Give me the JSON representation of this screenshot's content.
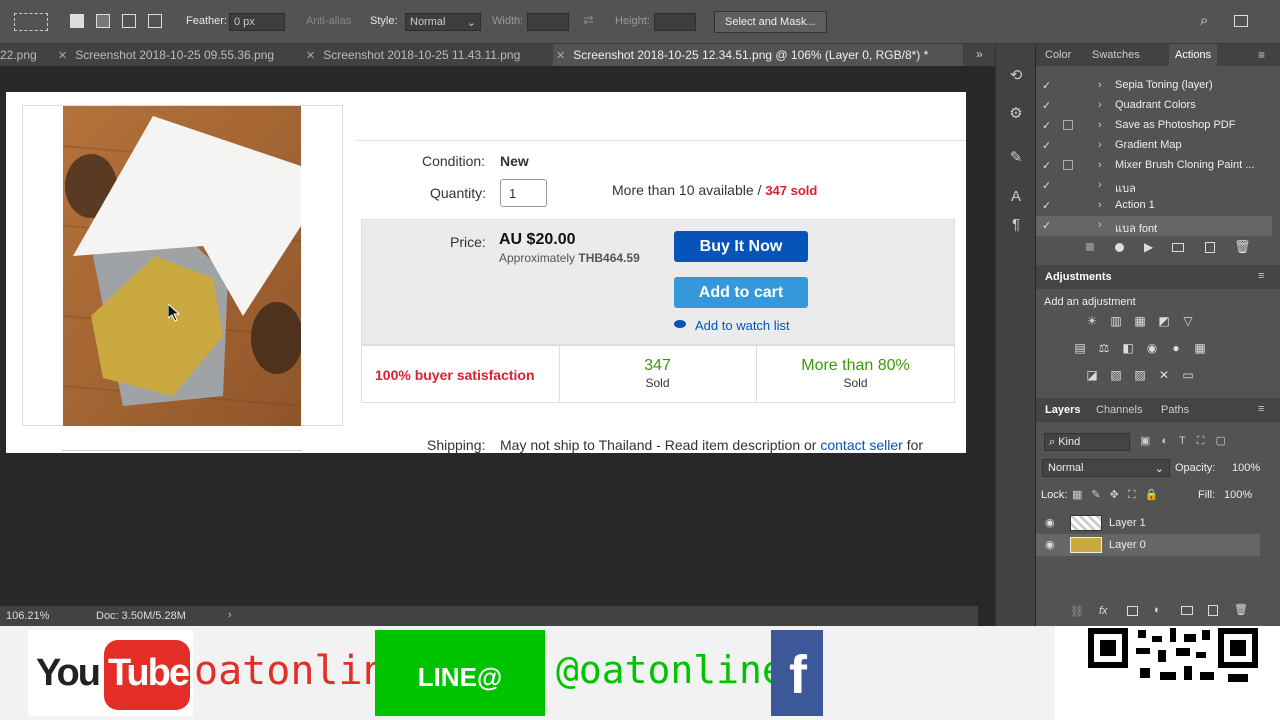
{
  "options_bar": {
    "feather_label": "Feather:",
    "feather_value": "0 px",
    "anti_alias_label": "Anti-alias",
    "style_label": "Style:",
    "style_value": "Normal",
    "width_label": "Width:",
    "height_label": "Height:",
    "select_mask_label": "Select and Mask..."
  },
  "tabs": [
    {
      "label": "22.png"
    },
    {
      "label": "Screenshot 2018-10-25 09.55.36.png"
    },
    {
      "label": "Screenshot 2018-10-25 11.43.11.png"
    },
    {
      "label": "Screenshot 2018-10-25 12.34.51.png @ 106% (Layer 0, RGB/8*) *"
    }
  ],
  "listing": {
    "condition_label": "Condition:",
    "condition_value": "New",
    "quantity_label": "Quantity:",
    "quantity_value": "1",
    "availability": "More than 10 available /",
    "sold_count": "347 sold",
    "price_label": "Price:",
    "price_value": "AU $20.00",
    "approx_label": "Approximately",
    "approx_value": "THB464.59",
    "buy_now": "Buy It Now",
    "add_to_cart": "Add to cart",
    "watch": "Add to watch list",
    "satisfaction": "100% buyer satisfaction",
    "stat_sold_num": "347",
    "stat_sold_label": "Sold",
    "stat_pct_num": "More than 80%",
    "stat_pct_label": "Sold",
    "shipping_label": "Shipping:",
    "shipping_text": "May not ship to Thailand - Read item description or",
    "contact_seller": "contact seller",
    "shipping_tail": "for"
  },
  "status_bar": {
    "zoom": "106.21%",
    "doc": "Doc: 3.50M/5.28M"
  },
  "panel_tabs": {
    "color": "Color",
    "swatches": "Swatches",
    "actions": "Actions"
  },
  "actions": [
    {
      "label": "Sepia Toning (layer)",
      "box": false
    },
    {
      "label": "Quadrant Colors",
      "box": false
    },
    {
      "label": "Save as Photoshop PDF",
      "box": true
    },
    {
      "label": "Gradient Map",
      "box": false
    },
    {
      "label": "Mixer Brush Cloning Paint ...",
      "box": true
    },
    {
      "label": "แบล",
      "box": false
    },
    {
      "label": "Action 1",
      "box": false
    },
    {
      "label": "แบล font",
      "box": false
    }
  ],
  "adjustments": {
    "title": "Adjustments",
    "subtitle": "Add an adjustment"
  },
  "layers_tabs": {
    "layers": "Layers",
    "channels": "Channels",
    "paths": "Paths"
  },
  "layers_panel": {
    "kind": "Kind",
    "blend_mode": "Normal",
    "opacity_label": "Opacity:",
    "opacity_value": "100%",
    "lock_label": "Lock:",
    "fill_label": "Fill:",
    "fill_value": "100%",
    "layers": [
      {
        "name": "Layer 1"
      },
      {
        "name": "Layer 0"
      }
    ]
  },
  "banner": {
    "youtube_you": "You",
    "youtube_tube": "Tube",
    "channel": "oatonline",
    "line": "LINE@",
    "line_id": "@oatonline",
    "fb": "f"
  },
  "colors": {
    "buy_now_blue": "#0654ba",
    "add_cart_blue": "#3498db",
    "sold_red": "#dd1e31",
    "stat_green": "#3a9a06",
    "line_green": "#00c300",
    "youtube_red": "#e52d27",
    "fb_blue": "#3b5998"
  }
}
